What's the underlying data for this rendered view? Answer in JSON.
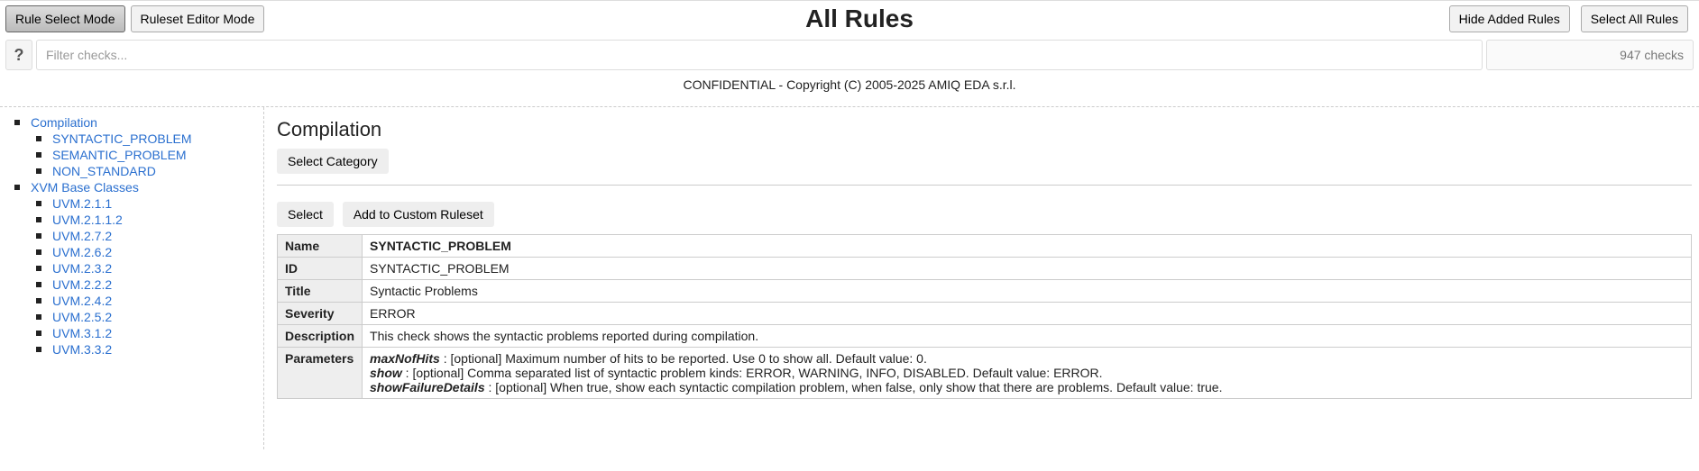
{
  "topbar": {
    "mode_rule_select": "Rule Select Mode",
    "mode_ruleset_editor": "Ruleset Editor Mode",
    "title": "All Rules",
    "hide_added": "Hide Added Rules",
    "select_all": "Select All Rules"
  },
  "filter": {
    "help": "?",
    "placeholder": "Filter checks...",
    "count": "947 checks"
  },
  "copyright": "CONFIDENTIAL - Copyright (C) 2005-2025 AMIQ EDA s.r.l.",
  "sidebar": {
    "groups": {
      "g0": {
        "label": "Compilation"
      },
      "g1": {
        "label": "XVM Base Classes"
      }
    },
    "items": {
      "g0_0": "SYNTACTIC_PROBLEM",
      "g0_1": "SEMANTIC_PROBLEM",
      "g0_2": "NON_STANDARD",
      "g1_0": "UVM.2.1.1",
      "g1_1": "UVM.2.1.1.2",
      "g1_2": "UVM.2.7.2",
      "g1_3": "UVM.2.6.2",
      "g1_4": "UVM.2.3.2",
      "g1_5": "UVM.2.2.2",
      "g1_6": "UVM.2.4.2",
      "g1_7": "UVM.2.5.2",
      "g1_8": "UVM.3.1.2",
      "g1_9": "UVM.3.3.2"
    }
  },
  "content": {
    "category_title": "Compilation",
    "select_category": "Select Category",
    "select": "Select",
    "add_to_custom": "Add to Custom Ruleset",
    "table": {
      "h_name": "Name",
      "v_name": "SYNTACTIC_PROBLEM",
      "h_id": "ID",
      "v_id": "SYNTACTIC_PROBLEM",
      "h_title": "Title",
      "v_title": "Syntactic Problems",
      "h_severity": "Severity",
      "v_severity": "ERROR",
      "h_description": "Description",
      "v_description": "This check shows the syntactic problems reported during compilation.",
      "h_parameters": "Parameters",
      "params": {
        "p0_name": "maxNofHits",
        "p0_desc": " : [optional] Maximum number of hits to be reported. Use 0 to show all. Default value: 0.",
        "p1_name": "show",
        "p1_desc": " : [optional] Comma separated list of syntactic problem kinds: ERROR, WARNING, INFO, DISABLED. Default value: ERROR.",
        "p2_name": "showFailureDetails",
        "p2_desc": " : [optional] When true, show each syntactic compilation problem, when false, only show that there are problems. Default value: true."
      }
    }
  }
}
